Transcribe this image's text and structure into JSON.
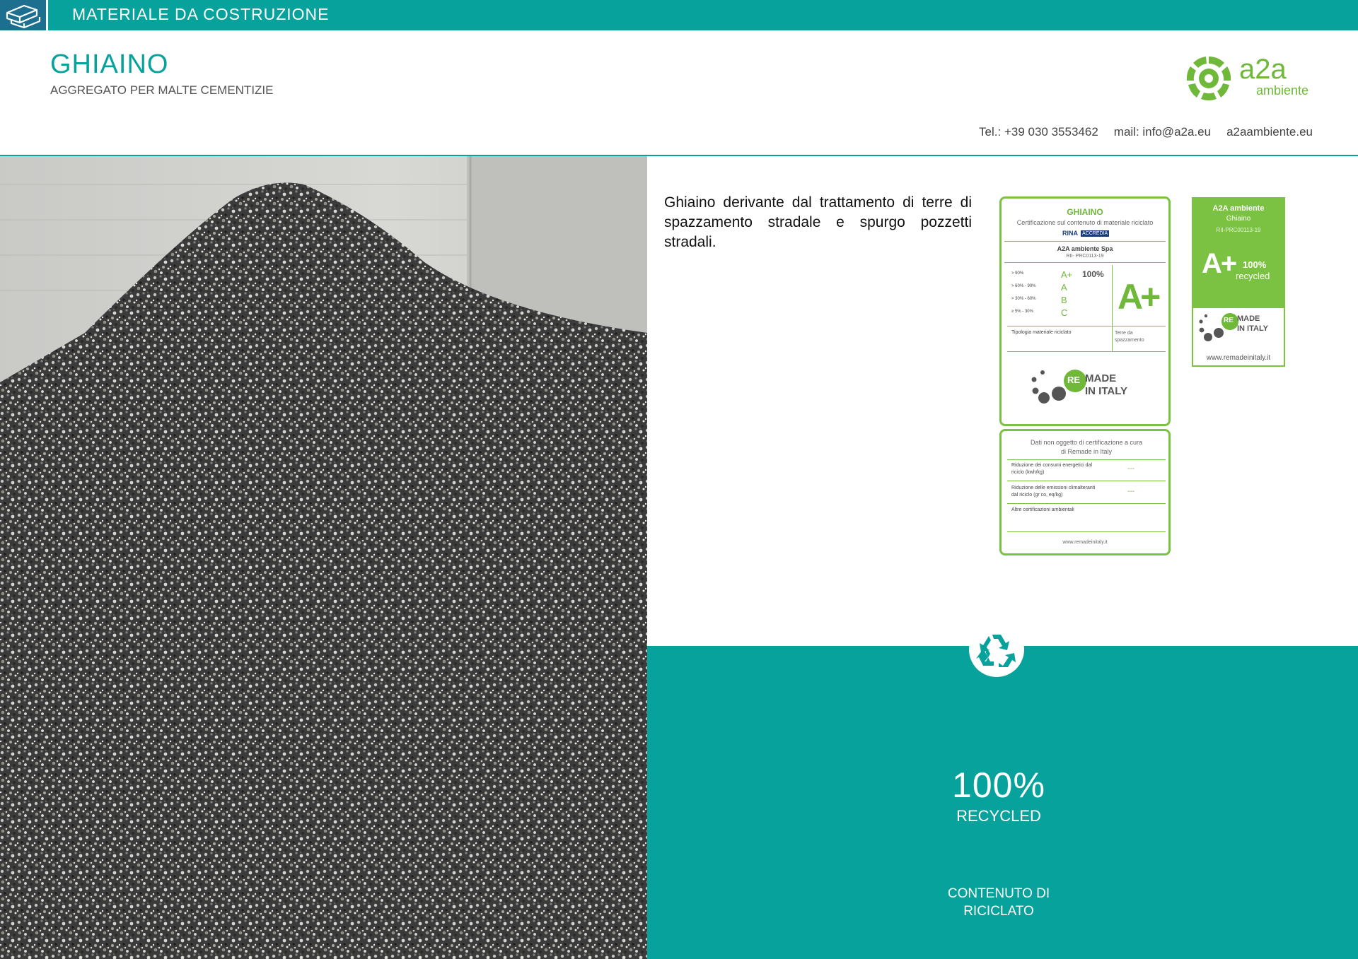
{
  "topbar": {
    "icon": "bricks-icon",
    "title": "MATERIALE DA COSTRUZIONE"
  },
  "header": {
    "title": "GHIAINO",
    "subtitle": "AGGREGATO PER MALTE CEMENTIZIE",
    "logo": {
      "name": "a2a",
      "sub": "ambiente"
    },
    "contact": {
      "tel": "Tel.:  +39 030 3553462",
      "mail": "mail: info@a2a.eu",
      "web": "a2aambiente.eu"
    }
  },
  "description": "Ghiaino derivante dal trattamento di terre di spazzamento stradale e spurgo pozzetti stradali.",
  "certificate": {
    "title": "GHIAINO",
    "subtitle": "Certificazione sul contenuto di materiale riciclato",
    "org_logo_1": "RINA",
    "org_logo_2": "ACCREDIA",
    "company": "A2A ambiente Spa",
    "code": "RII- PRC0113-19",
    "scale": [
      {
        "range": "> 90%",
        "grade": "A+"
      },
      {
        "range": "> 60% - 90%",
        "grade": "A"
      },
      {
        "range": "> 30% - 60%",
        "grade": "B"
      },
      {
        "range": "≥ 5% - 30%",
        "grade": "C"
      }
    ],
    "percent": "100%",
    "big_grade": "A+",
    "material_type_label": "Tipologia materiale riciclato",
    "material_type_value": "Terre da spazzamento",
    "remade_logo": {
      "re": "RE",
      "line1": "MADE",
      "line2": "IN ITALY"
    },
    "lower_title": "Dati non oggetto di certificazione a cura di Remade in Italy",
    "lower_rows": [
      {
        "label": "Riduzione dei consumi energetici dal riciclo (kwh/kg)",
        "value": "---"
      },
      {
        "label": "Riduzione delle emissioni climalteranti dal riciclo (gr co, eq/kg)",
        "value": "---"
      },
      {
        "label": "Altre certificazioni ambientali",
        "value": ""
      }
    ],
    "lower_url": "www.remadeinitaly.it"
  },
  "badge": {
    "company": "A2A ambiente",
    "product": "Ghiaino",
    "code": "RII-PRC00113-19",
    "grade": "A+",
    "percent": "100%",
    "recycled": "recycled",
    "url": "www.remadeinitaly.it"
  },
  "panel": {
    "icon": "recycle-icon",
    "percent": "100%",
    "recycled": "RECYCLED",
    "content_line1": "CONTENUTO DI",
    "content_line2": "RICICLATO"
  },
  "colors": {
    "teal": "#07a29c",
    "green": "#7cc242",
    "dark_blue": "#1d6f8f"
  }
}
